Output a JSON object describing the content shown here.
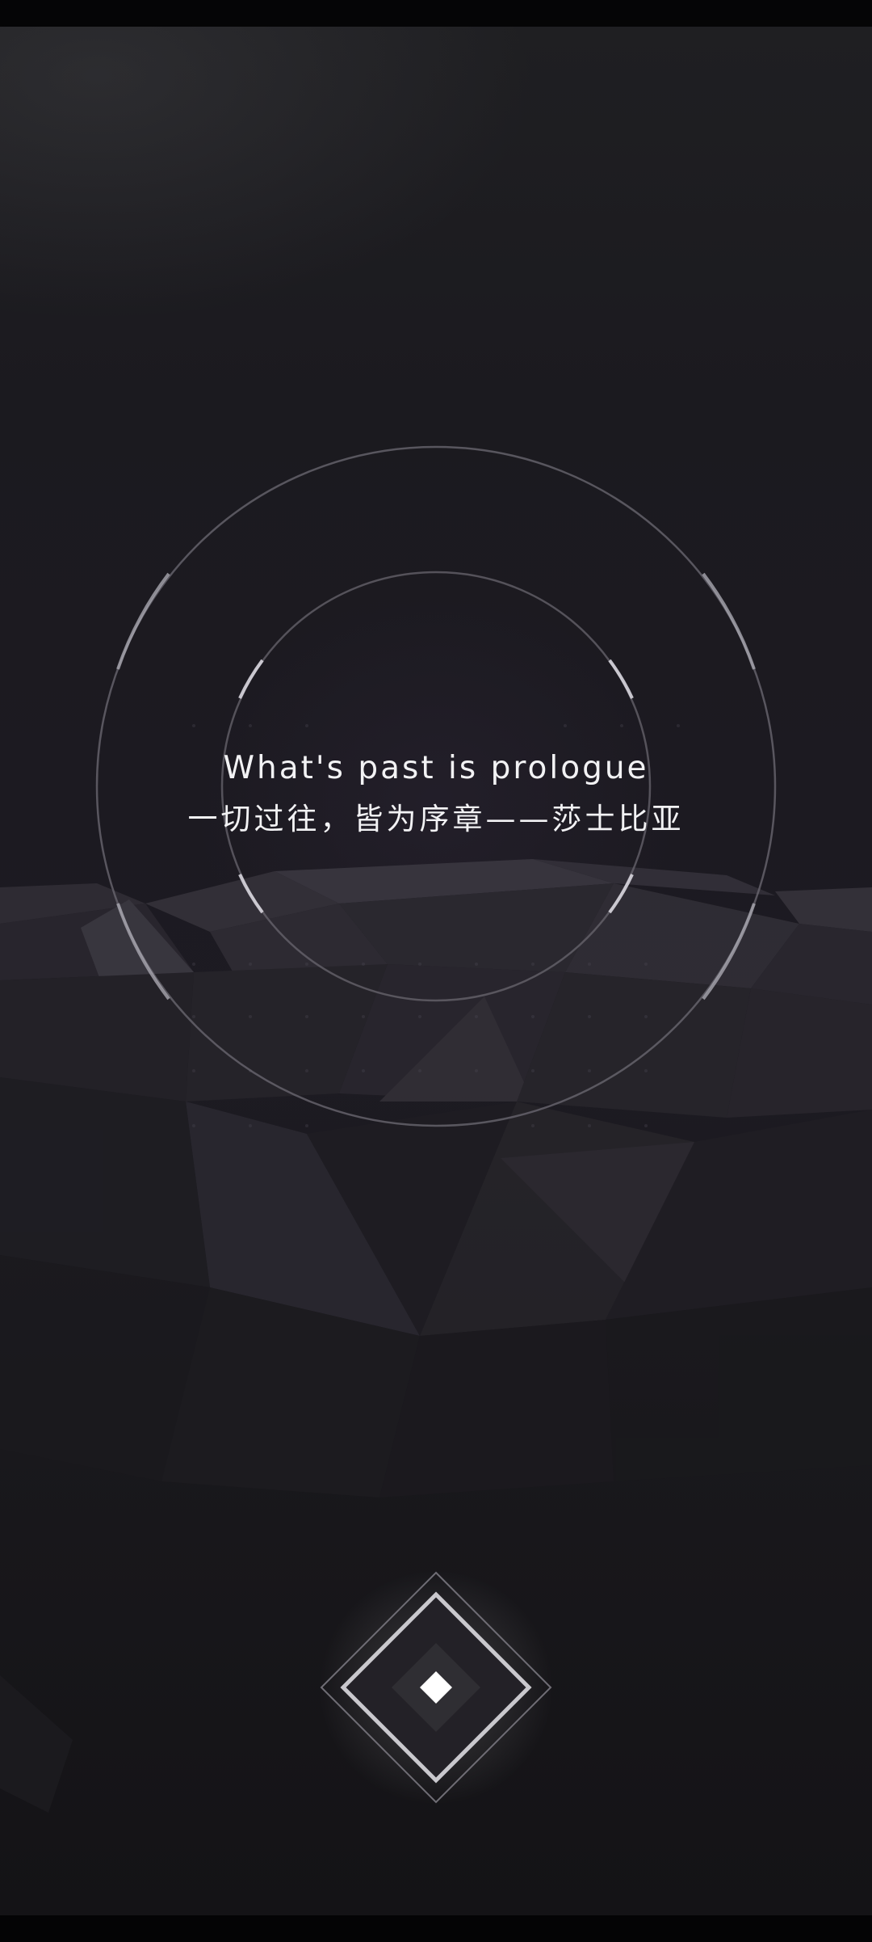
{
  "quote": {
    "english": "What's past is prologue",
    "chinese": "一切过往，皆为序章——莎士比亚"
  },
  "start_button": {
    "icon": "diamond-icon"
  },
  "colors": {
    "background": "#1c1a21",
    "ring": "#8f8d97",
    "text": "#f2f2f4",
    "button_glow": "#ffffff"
  }
}
